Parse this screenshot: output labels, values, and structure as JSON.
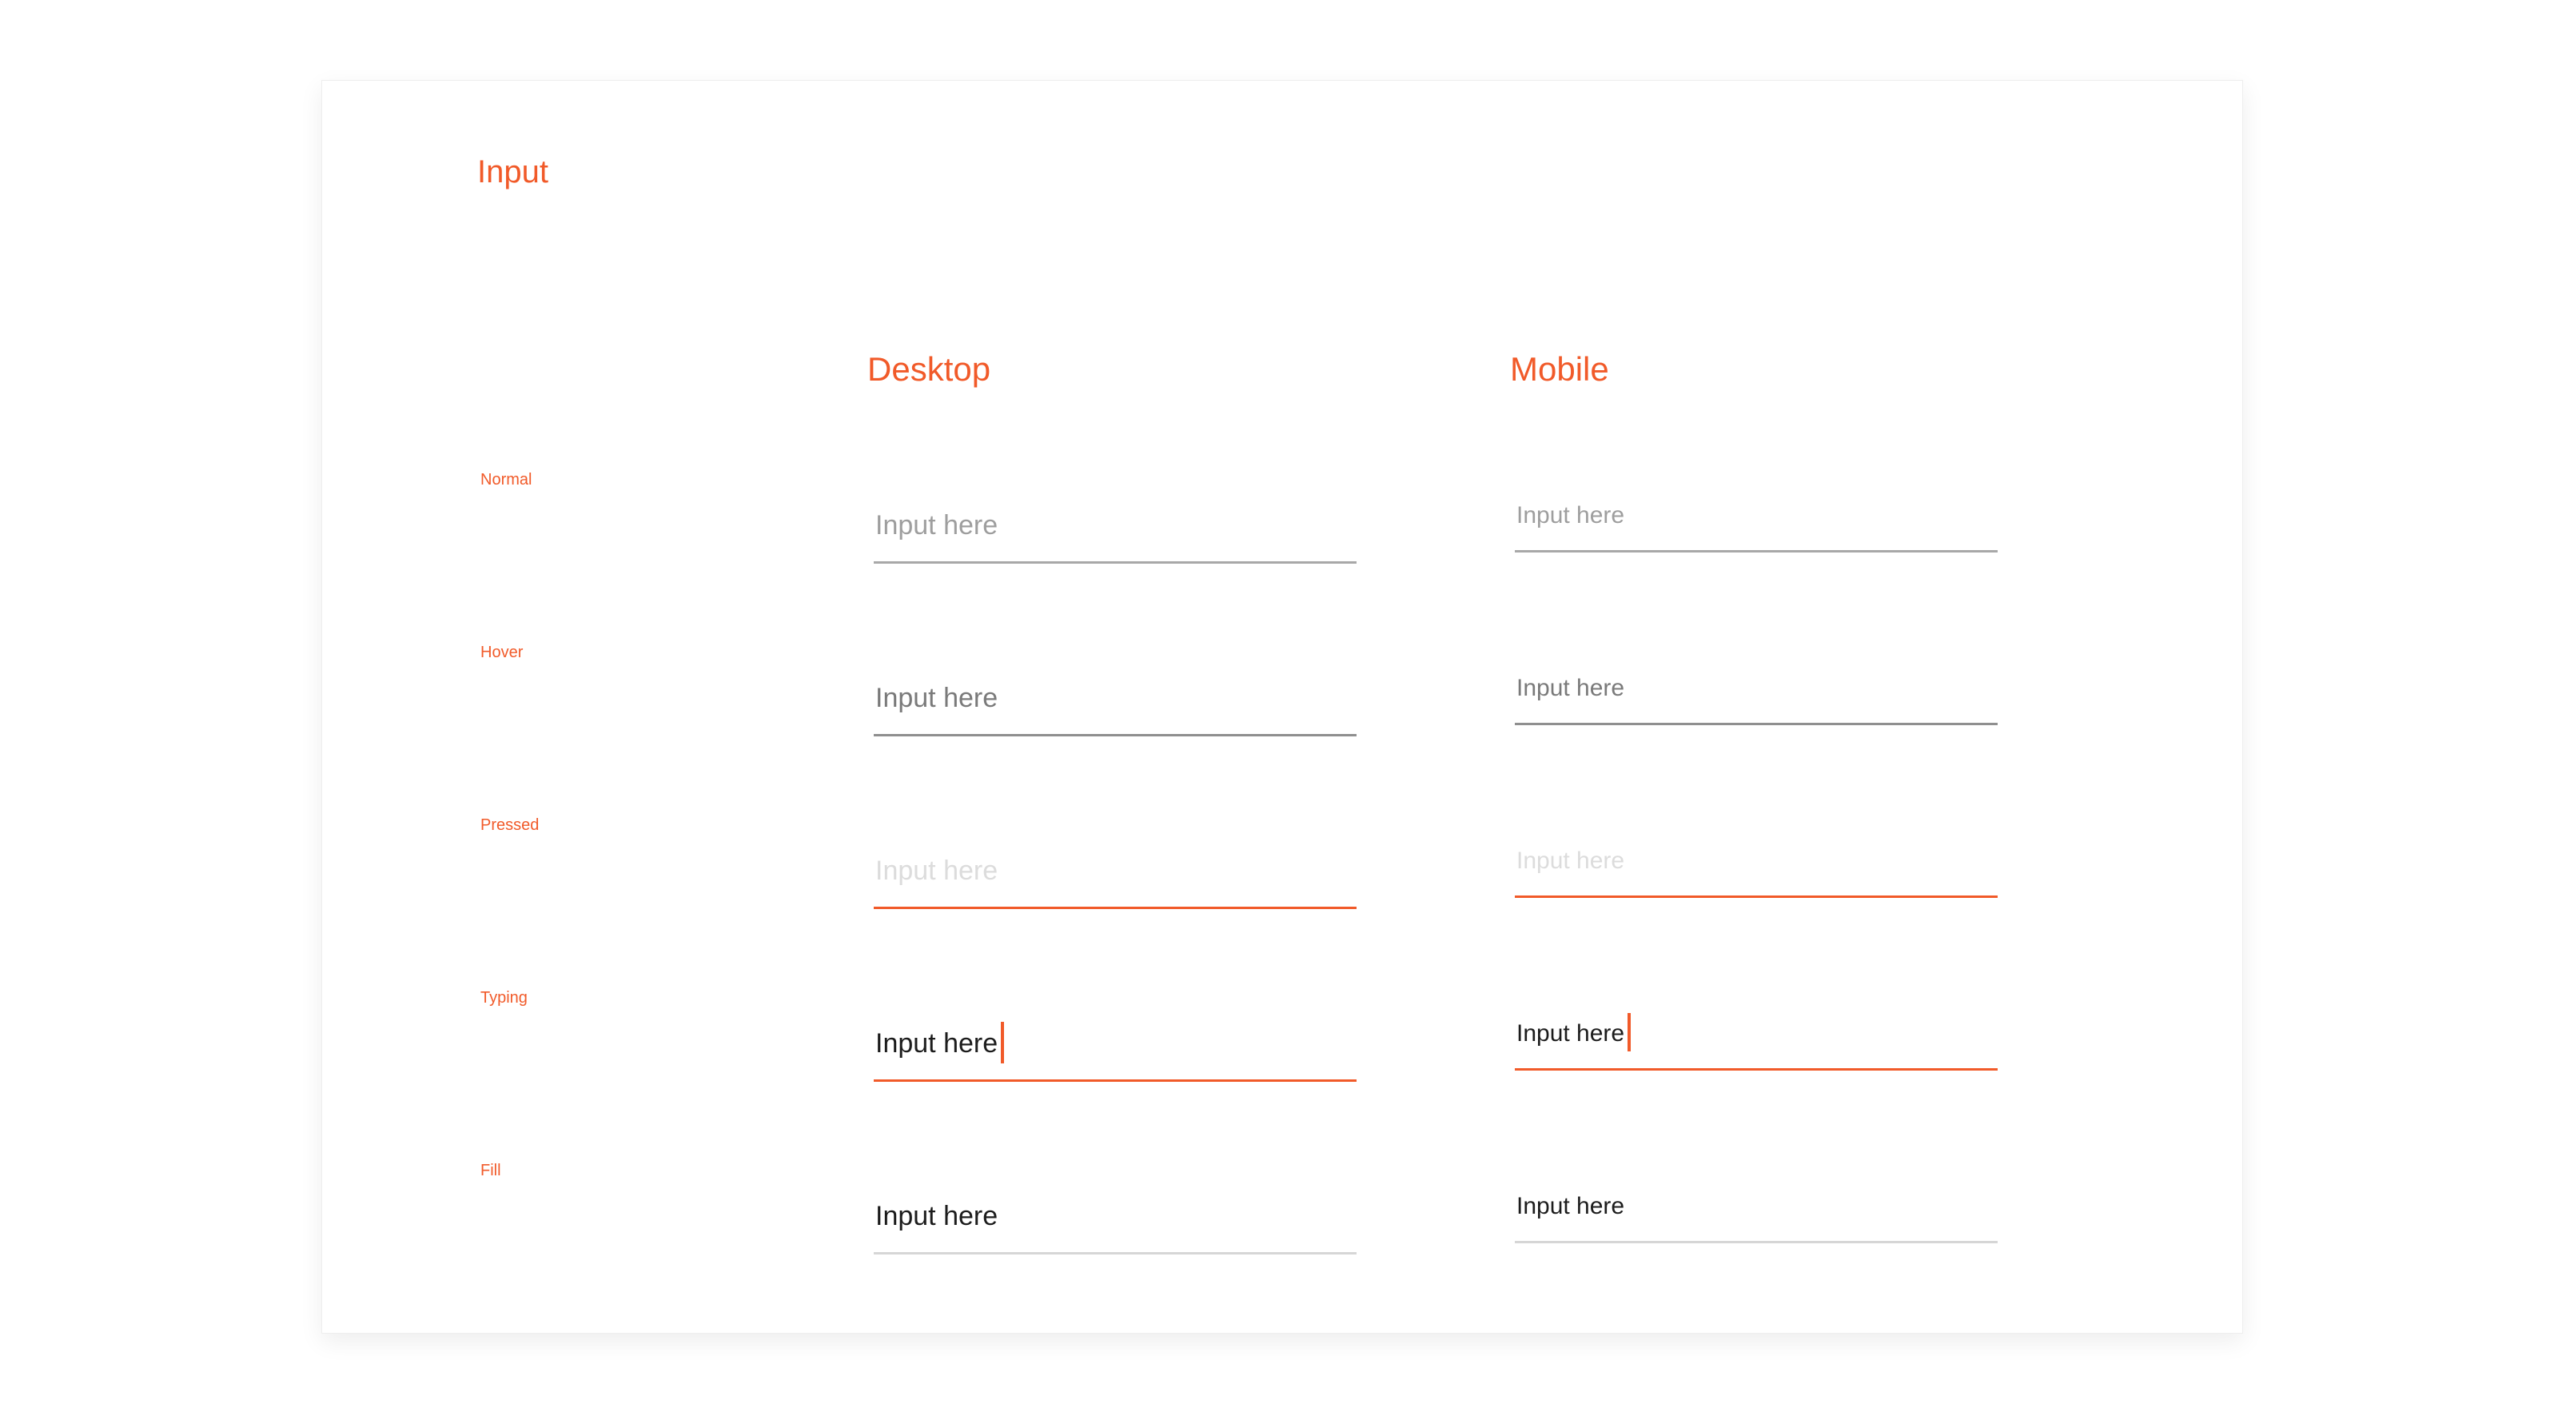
{
  "page": {
    "title": "Input"
  },
  "columns": {
    "desktop": "Desktop",
    "mobile": "Mobile"
  },
  "states": [
    {
      "label": "Normal",
      "desktop_value": "Input here",
      "mobile_value": "Input here"
    },
    {
      "label": "Hover",
      "desktop_value": "Input here",
      "mobile_value": "Input here"
    },
    {
      "label": "Pressed",
      "desktop_value": "Input here",
      "mobile_value": "Input here"
    },
    {
      "label": "Typing",
      "desktop_value": "Input here",
      "mobile_value": "Input here"
    },
    {
      "label": "Fill",
      "desktop_value": "Input here",
      "mobile_value": "Input here"
    }
  ],
  "colors": {
    "accent": "#f15a29",
    "underline_default": "#a8a8a8",
    "placeholder": "#9e9e9e",
    "text_filled": "#1c1c1c"
  }
}
